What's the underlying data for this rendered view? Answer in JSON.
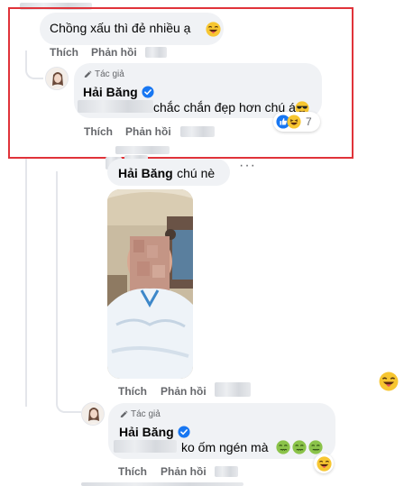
{
  "actions": {
    "like_label": "Thích",
    "reply_label": "Phản hồi"
  },
  "author_badge": "Tác giả",
  "comment1": {
    "text": "Chồng xấu thì đẻ nhiều ạ"
  },
  "reply1": {
    "author_name": "Hải Băng",
    "text": "chắc chắn đẹp hơn chú á",
    "reaction_count": "7"
  },
  "comment2": {
    "author_name": "Hải Băng",
    "text": "chú nè",
    "more_icon": "more-horizontal-icon"
  },
  "reply2": {
    "author_name": "Hải Băng",
    "text": "ko ốm ngén mà"
  },
  "colors": {
    "highlight_border": "#e0333a",
    "bubble": "#f0f2f5",
    "verified": "#1877f2",
    "muted_text": "#65676b"
  }
}
